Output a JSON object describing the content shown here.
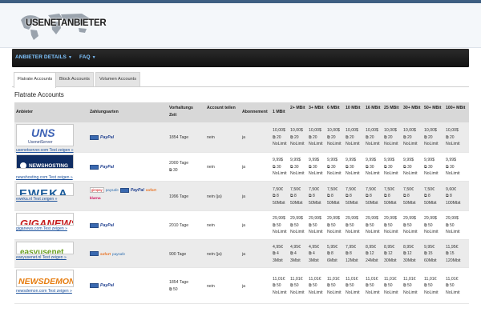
{
  "brand": {
    "logo_text_1": "USENET",
    "logo_text_2": "ANBIETER"
  },
  "nav": {
    "items": [
      {
        "label": "ANBIETER DETAILS"
      },
      {
        "label": "FAQ"
      }
    ]
  },
  "tabs": [
    {
      "label": "Flatrate Accounts",
      "active": true
    },
    {
      "label": "Block Accounts",
      "active": false
    },
    {
      "label": "Volumen Accounts",
      "active": false
    }
  ],
  "section_title": "Flatrate Accounts",
  "table": {
    "headers": [
      "Anbieter",
      "Zahlungsarten",
      "Vorhaltungs Zeit",
      "Account teilen",
      "Abonnement",
      "1 MBit",
      "2+ MBit",
      "3+ MBit",
      "6 MBit",
      "10 MBit",
      "16 MBit",
      "25 MBit",
      "30+ MBit",
      "50+ MBit",
      "100+ MBit"
    ],
    "rows": [
      {
        "logo": "UsenetServer",
        "link": "usenetserver.com Test zeigen »",
        "payments": [
          "PayPal"
        ],
        "retention": "1854 Tage",
        "retention_conn": "",
        "share": "nein",
        "abo": "ja",
        "prices": [
          "10,00$",
          "10,00$",
          "10,00$",
          "10,00$",
          "10,00$",
          "10,00$",
          "10,00$",
          "10,00$",
          "10,00$",
          "10,00$"
        ],
        "conns": [
          "20",
          "20",
          "20",
          "20",
          "20",
          "20",
          "20",
          "20",
          "20",
          "20"
        ],
        "speeds": [
          "NoLimit",
          "NoLimit",
          "NoLimit",
          "NoLimit",
          "NoLimit",
          "NoLimit",
          "NoLimit",
          "NoLimit",
          "NoLimit",
          "NoLimit"
        ]
      },
      {
        "logo": "NEWSHOSTING",
        "link": "newshosting.com Test zeigen »",
        "payments": [
          "PayPal"
        ],
        "retention": "2000 Tage",
        "retention_conn": "30",
        "share": "nein",
        "abo": "ja",
        "prices": [
          "9,99$",
          "9,99$",
          "9,99$",
          "9,99$",
          "9,99$",
          "9,99$",
          "9,99$",
          "9,99$",
          "9,99$",
          "9,99$"
        ],
        "conns": [
          "30",
          "30",
          "30",
          "30",
          "30",
          "30",
          "30",
          "30",
          "30",
          "30"
        ],
        "speeds": [
          "NoLimit",
          "NoLimit",
          "NoLimit",
          "NoLimit",
          "NoLimit",
          "NoLimit",
          "NoLimit",
          "NoLimit",
          "NoLimit",
          "NoLimit"
        ]
      },
      {
        "logo": "EWEKA",
        "link": "eweka.nl Test zeigen »",
        "payments": [
          "giropay",
          "paysafe",
          "PayPal",
          "sofort",
          "klarna"
        ],
        "retention": "1996 Tage",
        "retention_conn": "",
        "share": "nein (ja)",
        "abo": "ja",
        "prices": [
          "7,50€",
          "7,50€",
          "7,50€",
          "7,50€",
          "7,50€",
          "7,50€",
          "7,50€",
          "7,50€",
          "7,50€",
          "9,60€"
        ],
        "conns": [
          "8",
          "8",
          "8",
          "8",
          "8",
          "8",
          "8",
          "8",
          "8",
          "8"
        ],
        "speeds": [
          "50Mbit",
          "50Mbit",
          "50Mbit",
          "50Mbit",
          "50Mbit",
          "50Mbit",
          "50Mbit",
          "50Mbit",
          "50Mbit",
          "100Mbit"
        ]
      },
      {
        "logo": "GIGANEWS",
        "link": "giganews.com Test zeigen »",
        "payments": [
          "PayPal"
        ],
        "retention": "2010 Tage",
        "retention_conn": "",
        "share": "nein",
        "abo": "ja",
        "prices": [
          "29,99$",
          "29,99$",
          "29,99$",
          "29,99$",
          "29,99$",
          "29,99$",
          "29,99$",
          "29,99$",
          "29,99$",
          "29,99$"
        ],
        "conns": [
          "50",
          "50",
          "50",
          "50",
          "50",
          "50",
          "50",
          "50",
          "50",
          "50"
        ],
        "speeds": [
          "NoLimit",
          "NoLimit",
          "NoLimit",
          "NoLimit",
          "NoLimit",
          "NoLimit",
          "NoLimit",
          "NoLimit",
          "NoLimit",
          "NoLimit"
        ]
      },
      {
        "logo": "easyusenet",
        "link": "easyusenet.nl Test zeigen »",
        "payments": [
          "card",
          "sofort",
          "paysafe"
        ],
        "retention": "900 Tage",
        "retention_conn": "",
        "share": "nein (ja)",
        "abo": "ja",
        "prices": [
          "4,95€",
          "4,95€",
          "4,95€",
          "5,95€",
          "7,95€",
          "8,95€",
          "8,95€",
          "8,95€",
          "9,95€",
          "11,95€"
        ],
        "conns": [
          "4",
          "4",
          "4",
          "8",
          "8",
          "12",
          "12",
          "12",
          "15",
          "15"
        ],
        "speeds": [
          "3Mbit",
          "3Mbit",
          "3Mbit",
          "6Mbit",
          "12Mbit",
          "24Mbit",
          "30Mbit",
          "30Mbit",
          "60Mbit",
          "120Mbit"
        ]
      },
      {
        "logo": "NEWSDEMON",
        "link": "newsdemon.com Test zeigen »",
        "payments": [
          "PayPal"
        ],
        "retention": "1854 Tage",
        "retention_conn": "50",
        "share": "nein",
        "abo": "ja",
        "prices": [
          "11,01€",
          "11,01€",
          "11,01€",
          "11,01€",
          "11,01€",
          "11,01€",
          "11,01€",
          "11,01€",
          "11,01€",
          "11,01€"
        ],
        "conns": [
          "50",
          "50",
          "50",
          "50",
          "50",
          "50",
          "50",
          "50",
          "50",
          "50"
        ],
        "speeds": [
          "NoLimit",
          "NoLimit",
          "NoLimit",
          "NoLimit",
          "NoLimit",
          "NoLimit",
          "NoLimit",
          "NoLimit",
          "NoLimit",
          "NoLimit"
        ]
      }
    ]
  }
}
